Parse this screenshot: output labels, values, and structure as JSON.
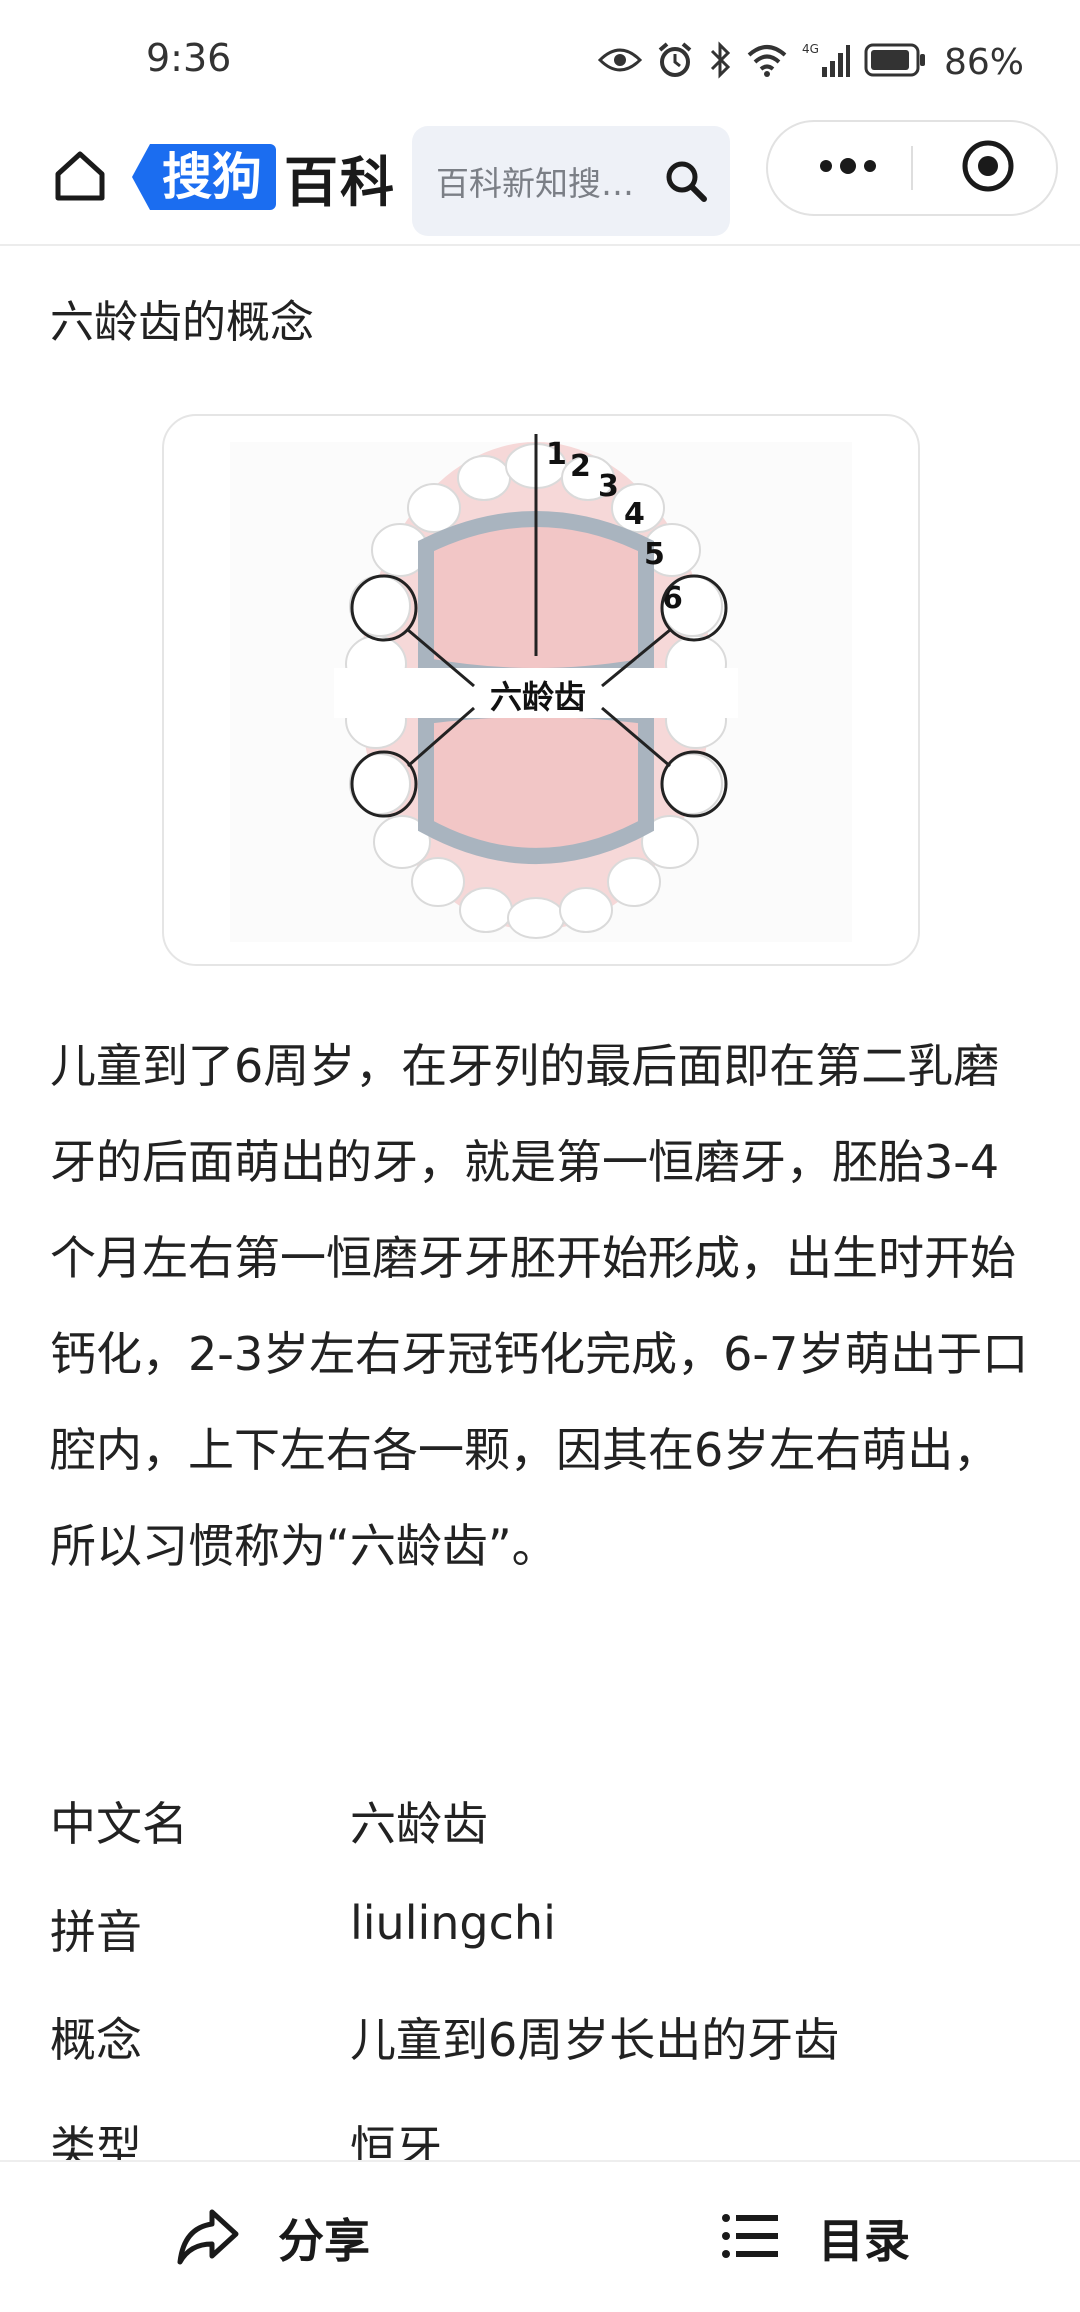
{
  "status_bar": {
    "time": "9:36",
    "network": "4G",
    "battery": "86%"
  },
  "nav": {
    "logo_badge": "搜狗",
    "logo_text": "百科",
    "search_placeholder": "百科新知搜…",
    "icons": [
      "home-icon",
      "search-icon",
      "more-icon",
      "close-target-icon"
    ]
  },
  "article": {
    "heading": "六龄齿的概念",
    "figure": {
      "numbers": [
        "1",
        "2",
        "3",
        "4",
        "5",
        "6"
      ],
      "label": "六龄齿"
    },
    "intro": "儿童到了6周岁，在牙列的最后面即在第二乳磨牙的后面萌出的牙，就是第一恒磨牙，胚胎3-4个月左右第一恒磨牙牙胚开始形成，出生时开始钙化，2-3岁左右牙冠钙化完成，6-7岁萌出于口腔内，上下左右各一颗，因其在6岁左右萌出，所以习惯称为“六龄齿”。",
    "info": [
      {
        "key": "中文名",
        "value": "六龄齿"
      },
      {
        "key": "拼音",
        "value": "liulingchi"
      },
      {
        "key": "概念",
        "value": "儿童到6周岁长出的牙齿"
      },
      {
        "key": "类型",
        "value": "恒牙"
      }
    ]
  },
  "bottom_bar": {
    "share": "分享",
    "toc": "目录"
  },
  "colors": {
    "brand_blue": "#1b6df0",
    "text": "#222222",
    "search_bg": "#eef1f7"
  }
}
